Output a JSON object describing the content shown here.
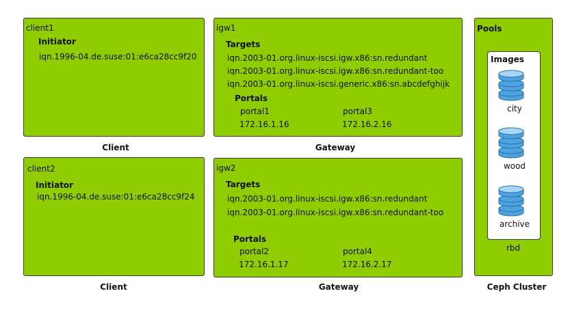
{
  "client1": {
    "name": "client1",
    "initiator_label": "Initiator",
    "iqn": "iqn.1996-04.de.suse:01:e6ca28cc9f20",
    "caption": "Client"
  },
  "client2": {
    "name": "client2",
    "initiator_label": "Initiator",
    "iqn": "iqn.1996-04.de.suse:01:e6ca28cc9f24",
    "caption": "Client"
  },
  "igw1": {
    "name": "igw1",
    "targets_label": "Targets",
    "targets": [
      "iqn.2003-01.org.linux-iscsi.igw.x86:sn.redundant",
      "iqn.2003-01.org.linux-iscsi.igw.x86:sn.redundant-too",
      "iqn.2003-01.org.linux-iscsi.generic.x86:sn.abcdefghijk"
    ],
    "portals_label": "Portals",
    "portals": [
      {
        "name": "portal1",
        "ip": "172.16.1.16"
      },
      {
        "name": "portal3",
        "ip": "172.16.2.16"
      }
    ],
    "caption": "Gateway"
  },
  "igw2": {
    "name": "igw2",
    "targets_label": "Targets",
    "targets": [
      "iqn.2003-01.org.linux-iscsi.igw.x86:sn.redundant",
      "iqn.2003-01.org.linux-iscsi.igw.x86:sn.redundant-too"
    ],
    "portals_label": "Portals",
    "portals": [
      {
        "name": "portal2",
        "ip": "172.16.1.17"
      },
      {
        "name": "portal4",
        "ip": "172.16.2.17"
      }
    ],
    "caption": "Gateway"
  },
  "cluster": {
    "pools_label": "Pools",
    "images_label": "Images",
    "images": [
      "city",
      "wood",
      "archive"
    ],
    "pool_name": "rbd",
    "caption": "Ceph Cluster"
  },
  "colors": {
    "box_fill": "#8fcc00",
    "border": "#3a3a3a",
    "db_blue": "#4da3e0"
  },
  "icons": {
    "database": "database-icon"
  }
}
